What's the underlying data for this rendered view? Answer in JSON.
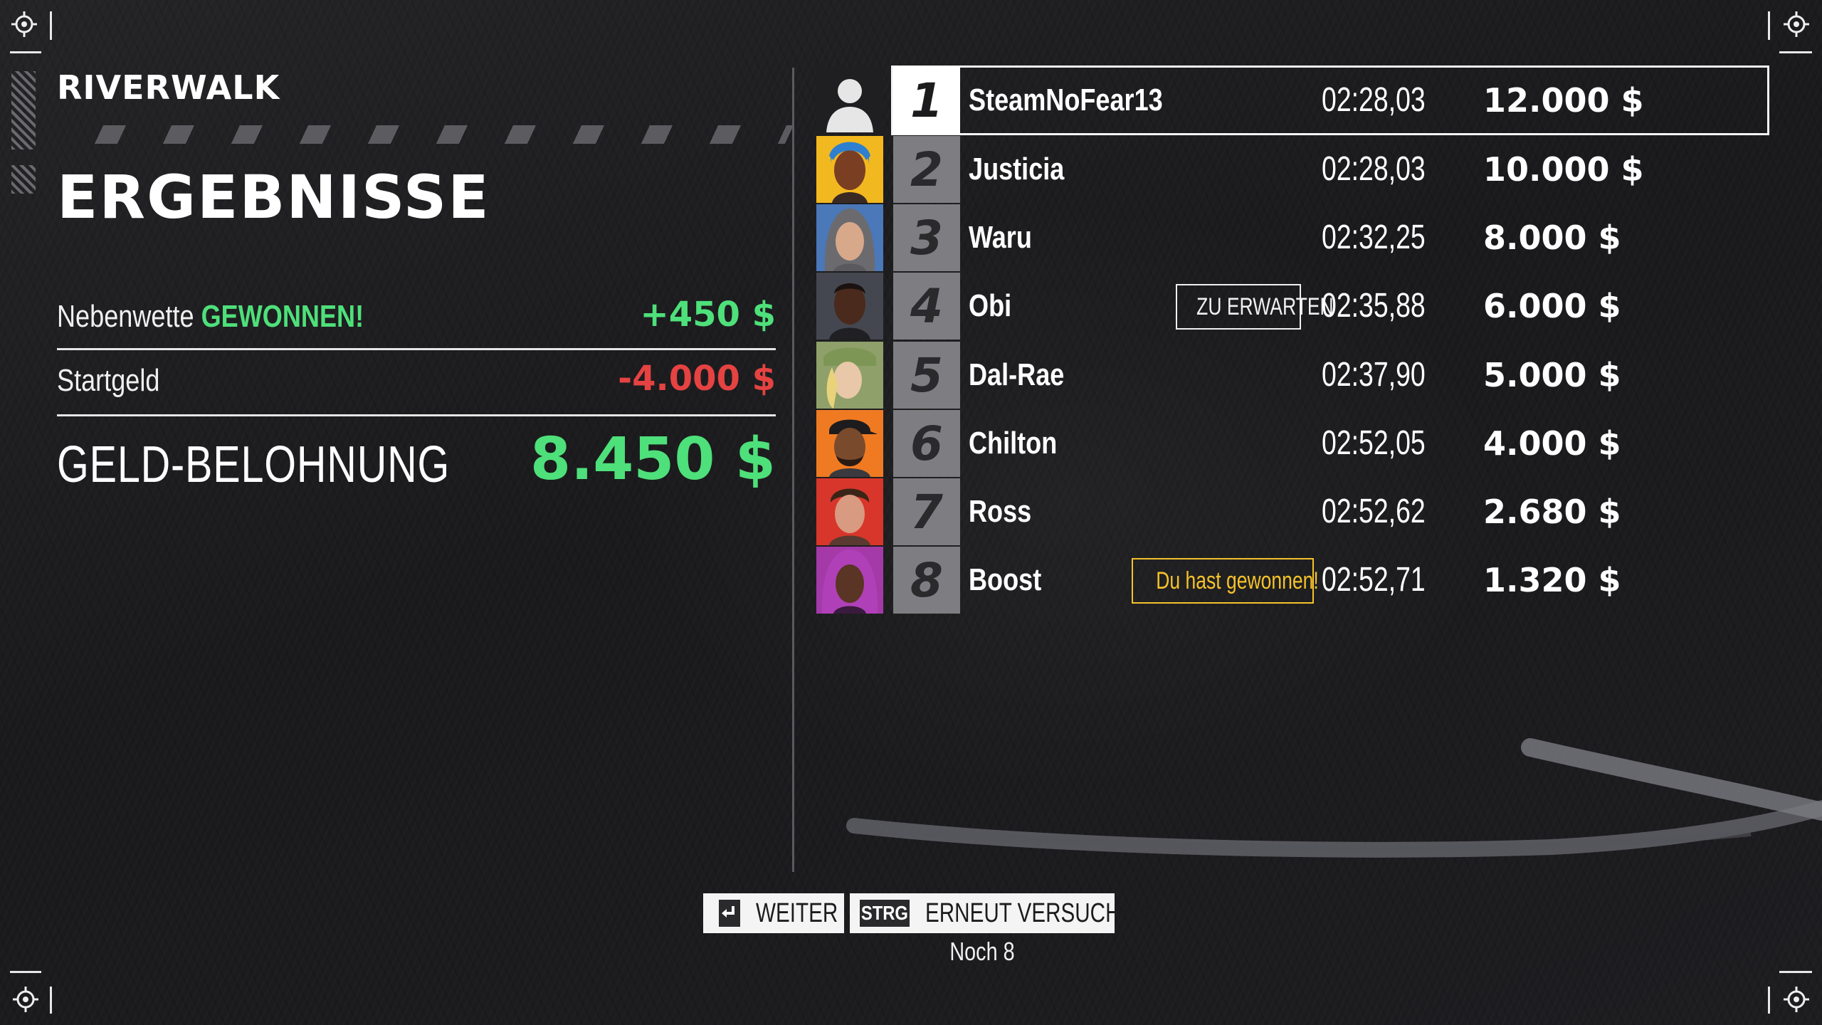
{
  "header": {
    "track": "RIVERWALK",
    "title": "ERGEBNISSE"
  },
  "summary": {
    "side_bet_label": "Nebenwette",
    "side_bet_status": "GEWONNEN!",
    "side_bet_value": "+450 $",
    "entry_fee_label": "Startgeld",
    "entry_fee_value": "-4.000 $",
    "total_label": "GELD-BELOHNUNG",
    "total_value": "8.450 $"
  },
  "standings": [
    {
      "position": "1",
      "name": "SteamNoFear13",
      "time": "02:28,03",
      "money": "12.000 $",
      "tag": "",
      "avatar": "default-silhouette-avatar"
    },
    {
      "position": "2",
      "name": "Justicia",
      "time": "02:28,03",
      "money": "10.000 $",
      "tag": "",
      "avatar": "justicia-avatar"
    },
    {
      "position": "3",
      "name": "Waru",
      "time": "02:32,25",
      "money": "8.000 $",
      "tag": "",
      "avatar": "waru-avatar"
    },
    {
      "position": "4",
      "name": "Obi",
      "time": "02:35,88",
      "money": "6.000 $",
      "tag": "ZU ERWARTEN",
      "avatar": "obi-avatar"
    },
    {
      "position": "5",
      "name": "Dal-Rae",
      "time": "02:37,90",
      "money": "5.000 $",
      "tag": "",
      "avatar": "dal-rae-avatar"
    },
    {
      "position": "6",
      "name": "Chilton",
      "time": "02:52,05",
      "money": "4.000 $",
      "tag": "",
      "avatar": "chilton-avatar"
    },
    {
      "position": "7",
      "name": "Ross",
      "time": "02:52,62",
      "money": "2.680 $",
      "tag": "",
      "avatar": "ross-avatar"
    },
    {
      "position": "8",
      "name": "Boost",
      "time": "02:52,71",
      "money": "1.320 $",
      "tag": "Du hast gewonnen!",
      "avatar": "boost-avatar"
    }
  ],
  "prompts": {
    "continue_key_icon": "enter-key-icon",
    "continue_label": "WEITER",
    "retry_key": "STRG",
    "retry_label": "ERNEUT VERSUCHEN",
    "remaining": "Noch 8"
  },
  "colors": {
    "positive": "#4ee07a",
    "negative": "#e54242",
    "win_tag": "#f5c22a",
    "background": "#1c1c1e"
  }
}
